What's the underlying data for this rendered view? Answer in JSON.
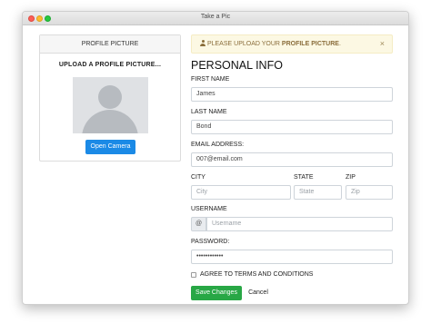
{
  "window": {
    "title": "Take a Pic"
  },
  "profile_card": {
    "header": "PROFILE PICTURE",
    "subtitle": "UPLOAD A PROFILE PICTURE...",
    "camera_button": "Open Camera"
  },
  "alert": {
    "prefix": "PLEASE UPLOAD YOUR ",
    "emphasis": "PROFILE PICTURE",
    "suffix": ".",
    "close": "×"
  },
  "form": {
    "heading": "PERSONAL INFO",
    "first_name": {
      "label": "FIRST NAME",
      "value": "James"
    },
    "last_name": {
      "label": "LAST NAME",
      "value": "Bond"
    },
    "email": {
      "label": "EMAIL ADDRESS:",
      "value": "007@email.com"
    },
    "city": {
      "label": "CITY",
      "placeholder": "City"
    },
    "state": {
      "label": "STATE",
      "placeholder": "State"
    },
    "zip": {
      "label": "ZIP",
      "placeholder": "Zip"
    },
    "username": {
      "label": "USERNAME",
      "prefix": "@",
      "placeholder": "Username"
    },
    "password": {
      "label": "PASSWORD:",
      "value": "••••••••••••"
    },
    "terms": {
      "label": "AGREE TO TERMS AND CONDITIONS",
      "checked": false
    },
    "save_button": "Save Changes",
    "cancel_button": "Cancel"
  },
  "colors": {
    "primary": "#1b8ae6",
    "success": "#28a745",
    "warning_bg": "#fcf8e3",
    "warning_text": "#8a6d3b"
  }
}
